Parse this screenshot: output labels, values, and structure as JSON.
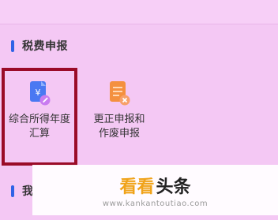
{
  "section": {
    "title": "税费申报"
  },
  "tiles": [
    {
      "label_line1": "综合所得年度",
      "label_line2": "汇算",
      "icon": "tax-document-edit-icon"
    },
    {
      "label_line1": "更正申报和",
      "label_line2": "作废申报",
      "icon": "tax-document-cancel-icon"
    }
  ],
  "bottom_section": {
    "title": "我"
  },
  "watermark": {
    "brand_part1": "看看",
    "brand_part2": "头条",
    "url": "www.kankantoutiao.com"
  },
  "colors": {
    "accent": "#2f63e6",
    "highlight": "#9a0b28",
    "icon_blue": "#3b6ff0",
    "icon_orange": "#f08a3a"
  }
}
